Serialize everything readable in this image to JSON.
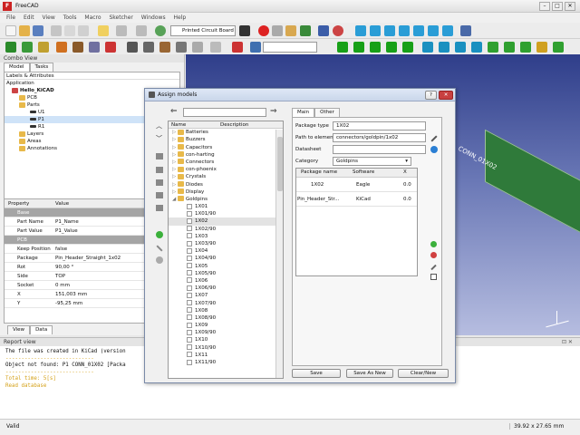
{
  "window": {
    "title": "FreeCAD",
    "logo": "F"
  },
  "menu": [
    "File",
    "Edit",
    "View",
    "Tools",
    "Macro",
    "Sketcher",
    "Windows",
    "Help"
  ],
  "workbench_dropdown": "Printed Circuit Board",
  "combo_view": {
    "title": "Combo View",
    "tabs": [
      "Model",
      "Tasks"
    ],
    "labels_header": "Labels & Attributes",
    "tree": {
      "root": "Application",
      "doc": "Hello_KiCAD",
      "items": [
        "PCB",
        "Parts",
        "U1",
        "P1",
        "R1",
        "Layers",
        "Areas",
        "Annotations"
      ]
    },
    "property_cols": [
      "Property",
      "Value"
    ],
    "properties": [
      {
        "group": "Base"
      },
      {
        "k": "Part Name",
        "v": "P1_Name"
      },
      {
        "k": "Part Value",
        "v": "P1_Value"
      },
      {
        "group": "PCB"
      },
      {
        "k": "Keep Position",
        "v": "false"
      },
      {
        "k": "Package",
        "v": "Pin_Header_Straight_1x02"
      },
      {
        "k": "Rot",
        "v": "90,00 °"
      },
      {
        "k": "Side",
        "v": "TOP"
      },
      {
        "k": "Socket",
        "v": "0 mm"
      },
      {
        "k": "X",
        "v": "151,003 mm"
      },
      {
        "k": "Y",
        "v": "-95,25 mm"
      }
    ],
    "bottom_tabs": [
      "View",
      "Data"
    ]
  },
  "viewport": {
    "label": "CONN_01X02"
  },
  "report": {
    "title": "Report view",
    "lines": [
      {
        "text": "The file was created in KiCad (version",
        "color": "#111111"
      },
      {
        "text": "----------------------------",
        "color": "#d4a017"
      },
      {
        "text": "Object not found: P1 CONN_01X02 [Packa",
        "color": "#111111"
      },
      {
        "text": "----------------------------",
        "color": "#d4a017"
      },
      {
        "text": "Total time: 5[s]",
        "color": "#d4a017"
      },
      {
        "text": "Read database",
        "color": "#d4a017"
      }
    ]
  },
  "status": {
    "left": "Valid",
    "right": "39.92 x 27.65 mm"
  },
  "dialog": {
    "title": "Assign models",
    "list_cols": [
      "Name",
      "Description"
    ],
    "categories": [
      "Batteries",
      "Buzzers",
      "Capacitors",
      "con-harting",
      "Connectors",
      "con-phoenix",
      "Crystals",
      "Diodes",
      "Display",
      "Goldpins"
    ],
    "goldpins": [
      "1X01",
      "1X01/90",
      "1X02",
      "1X02/90",
      "1X03",
      "1X03/90",
      "1X04",
      "1X04/90",
      "1X05",
      "1X05/90",
      "1X06",
      "1X06/90",
      "1X07",
      "1X07/90",
      "1X08",
      "1X08/90",
      "1X09",
      "1X09/90",
      "1X10",
      "1X10/90",
      "1X11",
      "1X11/90"
    ],
    "right_tabs": [
      "Main",
      "Other"
    ],
    "fields": {
      "package_type_label": "Package type",
      "package_type": "1X02",
      "path_label": "Path to element",
      "path": "connectors/goldpin/1x02",
      "datasheet_label": "Datasheet",
      "datasheet": "",
      "category_label": "Category",
      "category": "Goldpins"
    },
    "table_cols": [
      "Package name",
      "Software",
      "X"
    ],
    "table_rows": [
      {
        "name": "1X02",
        "software": "Eagle",
        "x": "0.0"
      },
      {
        "name": "Pin_Header_Str...",
        "software": "KiCad",
        "x": "0.0"
      }
    ],
    "buttons": {
      "save": "Save",
      "save_new": "Save As New",
      "clear": "Clear/New"
    },
    "help": "?",
    "close": "✕"
  }
}
